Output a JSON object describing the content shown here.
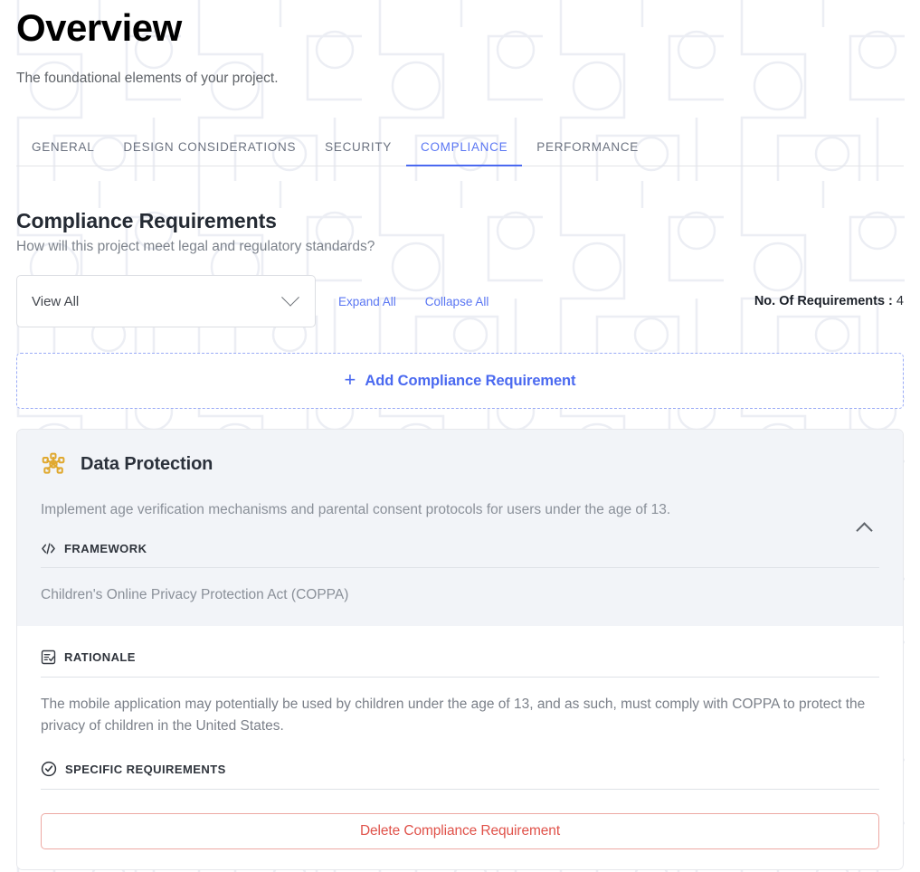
{
  "header": {
    "title": "Overview",
    "subtitle": "The foundational elements of your project."
  },
  "tabs": [
    {
      "label": "GENERAL",
      "active": false
    },
    {
      "label": "DESIGN CONSIDERATIONS",
      "active": false
    },
    {
      "label": "SECURITY",
      "active": false
    },
    {
      "label": "COMPLIANCE",
      "active": true
    },
    {
      "label": "PERFORMANCE",
      "active": false
    }
  ],
  "section": {
    "title": "Compliance Requirements",
    "subtitle": "How will this project meet legal and regulatory standards?"
  },
  "toolbar": {
    "view_select_value": "View All",
    "view_select_options": [
      "View All"
    ],
    "expand_all_label": "Expand All",
    "collapse_all_label": "Collapse All",
    "count_label": "No. Of Requirements :",
    "count_value": "4"
  },
  "add_button": {
    "plus": "+",
    "label": "Add Compliance Requirement"
  },
  "requirement": {
    "icon": "network-nodes-icon",
    "icon_color": "#e0a82e",
    "title": "Data Protection",
    "description": "Implement age verification mechanisms and parental consent protocols for users under the age of 13.",
    "framework": {
      "icon": "code-brackets-icon",
      "label": "FRAMEWORK",
      "value": "Children's Online Privacy Protection Act (COPPA)"
    },
    "rationale": {
      "icon": "list-check-icon",
      "label": "RATIONALE",
      "value": "The mobile application may potentially be used by children under the age of 13, and as such, must comply with COPPA to protect the privacy of children in the United States."
    },
    "specific_requirements": {
      "icon": "check-circle-icon",
      "label": "SPECIFIC REQUIREMENTS",
      "value": ""
    },
    "collapse_icon": "chevron-up-icon",
    "delete_label": "Delete Compliance Requirement"
  },
  "colors": {
    "accent": "#4a69f0",
    "tab_active": "#5a76f3",
    "danger": "#e0524a",
    "card_head_bg": "#f2f4f8",
    "icon_amber": "#e0a82e"
  }
}
